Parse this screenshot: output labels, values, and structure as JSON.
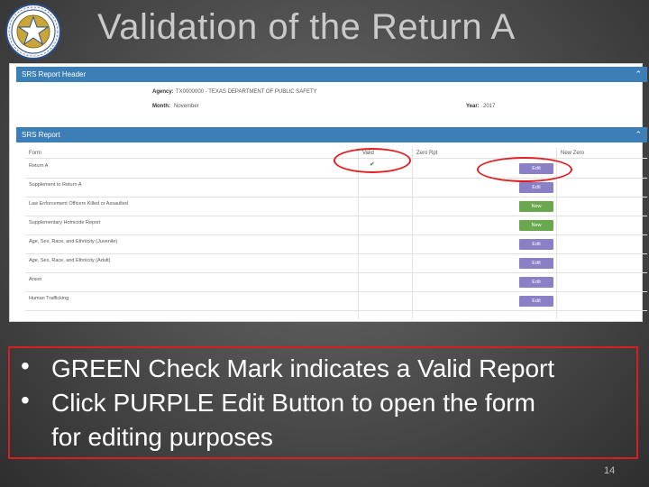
{
  "slide": {
    "title": "Validation of the Return A",
    "page_number": "14"
  },
  "header_panel": {
    "title": "SRS Report Header",
    "agency_label": "Agency:",
    "agency_value": "TX0000000 - TEXAS DEPARTMENT OF PUBLIC SAFETY",
    "month_label": "Month:",
    "month_value": "November",
    "year_label": "Year:",
    "year_value": "2017"
  },
  "report_panel": {
    "title": "SRS Report",
    "columns": [
      "Form",
      "Valid",
      "Zero Rpt",
      "New Zero"
    ],
    "rows": [
      {
        "form": "Return A",
        "valid": "✔",
        "action": "Edit",
        "type": "edit"
      },
      {
        "form": "Supplement to Return A",
        "valid": "",
        "action": "Edit",
        "type": "edit"
      },
      {
        "form": "Law Enforcement Officers Killed or Assaulted",
        "valid": "",
        "action": "New",
        "type": "new"
      },
      {
        "form": "Supplementary Homicide Report",
        "valid": "",
        "action": "New",
        "type": "new"
      },
      {
        "form": "Age, Sex, Race, and Ethnicity (Juvenile)",
        "valid": "",
        "action": "Edit",
        "type": "edit"
      },
      {
        "form": "Age, Sex, Race, and Ethnicity (Adult)",
        "valid": "",
        "action": "Edit",
        "type": "edit"
      },
      {
        "form": "Arson",
        "valid": "",
        "action": "Edit",
        "type": "edit"
      },
      {
        "form": "Human Trafficking",
        "valid": "",
        "action": "Edit",
        "type": "edit"
      }
    ]
  },
  "bullets": [
    {
      "dot": "•",
      "line1": "GREEN Check Mark indicates a Valid Report",
      "line2": ""
    },
    {
      "dot": "•",
      "line1": "Click PURPLE Edit Button to open the form",
      "line2": "for editing purposes"
    }
  ],
  "colors": {
    "edit_button": "#8b7fc6",
    "new_button": "#6aa84f",
    "panel_header": "#3b7fb6",
    "highlight": "#e02020"
  }
}
